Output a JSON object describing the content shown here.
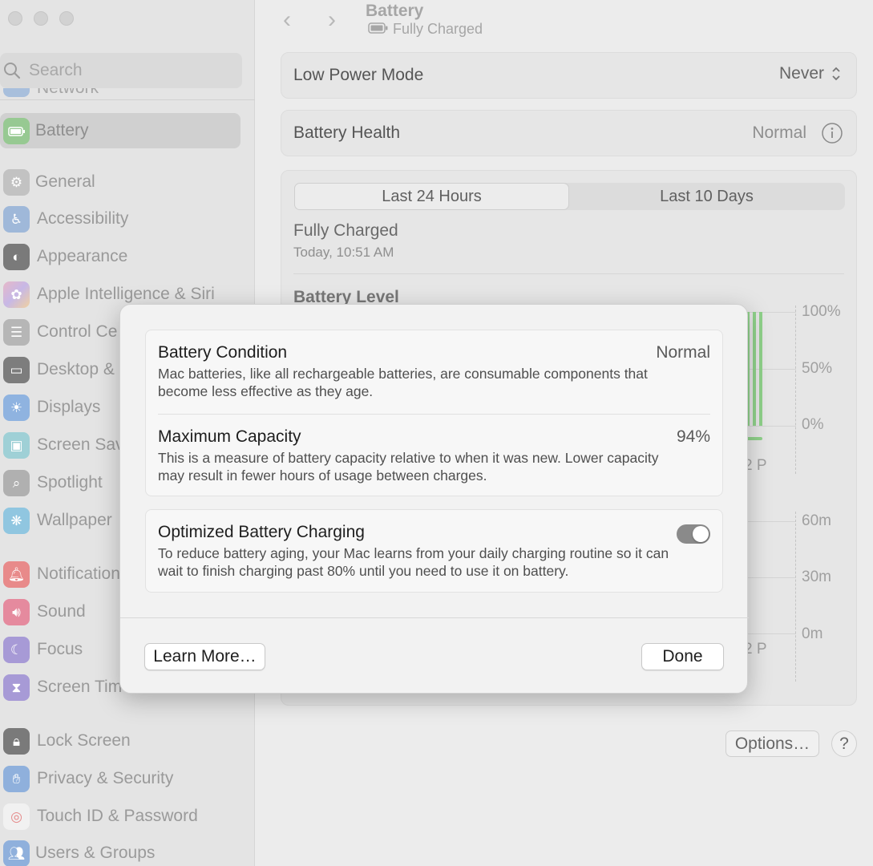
{
  "sidebar": {
    "search_placeholder": "Search",
    "network_partial": "Network",
    "active_item": "Battery",
    "items": [
      {
        "label": "General",
        "icon": "gear-icon"
      },
      {
        "label": "Accessibility",
        "icon": "accessibility-icon"
      },
      {
        "label": "Appearance",
        "icon": "appearance-icon"
      },
      {
        "label": "Apple Intelligence & Siri",
        "icon": "siri-icon"
      },
      {
        "label": "Control Ce",
        "icon": "control-center-icon"
      },
      {
        "label": "Desktop &",
        "icon": "desktop-dock-icon"
      },
      {
        "label": "Displays",
        "icon": "displays-icon"
      },
      {
        "label": "Screen Sav",
        "icon": "screen-saver-icon"
      },
      {
        "label": "Spotlight",
        "icon": "spotlight-icon"
      },
      {
        "label": "Wallpaper",
        "icon": "wallpaper-icon"
      },
      {
        "label": "Notification",
        "icon": "notifications-icon"
      },
      {
        "label": "Sound",
        "icon": "sound-icon"
      },
      {
        "label": "Focus",
        "icon": "focus-icon"
      },
      {
        "label": "Screen Tim",
        "icon": "screen-time-icon"
      },
      {
        "label": "Lock Screen",
        "icon": "lock-screen-icon"
      },
      {
        "label": "Privacy & Security",
        "icon": "privacy-hand-icon"
      },
      {
        "label": "Touch ID & Password",
        "icon": "fingerprint-icon"
      },
      {
        "label": "Users & Groups",
        "icon": "users-icon"
      }
    ]
  },
  "header": {
    "title": "Battery",
    "subtitle": "Fully Charged"
  },
  "settings": {
    "low_power_label": "Low Power Mode",
    "low_power_value": "Never",
    "health_label": "Battery Health",
    "health_value": "Normal"
  },
  "usage": {
    "tabs": [
      "Last 24 Hours",
      "Last 10 Days"
    ],
    "selected_tab": "Last 24 Hours",
    "status": "Fully Charged",
    "status_time": "Today, 10:51 AM",
    "level_heading": "Battery Level",
    "level_ticks": [
      "100%",
      "50%",
      "0%"
    ],
    "level_x_partial": "2 P",
    "activity_ticks": [
      "60m",
      "30m",
      "0m"
    ],
    "activity_x_partial": "2 P"
  },
  "footer": {
    "options_label": "Options…",
    "help_label": "?"
  },
  "dialog": {
    "condition_title": "Battery Condition",
    "condition_value": "Normal",
    "condition_desc": "Mac batteries, like all rechargeable batteries, are consumable components that become less effective as they age.",
    "capacity_title": "Maximum Capacity",
    "capacity_value": "94%",
    "capacity_desc": "This is a measure of battery capacity relative to when it was new. Lower capacity may result in fewer hours of usage between charges.",
    "optimized_title": "Optimized Battery Charging",
    "optimized_desc": "To reduce battery aging, your Mac learns from your daily charging routine so it can wait to finish charging past 80% until you need to use it on battery.",
    "optimized_enabled": true,
    "learn_more_label": "Learn More…",
    "done_label": "Done"
  },
  "colors": {
    "battery_green": "#7fcf7a",
    "sidebar_bg": "#e4e4e4",
    "sheet_bg": "#f2f2f2"
  }
}
